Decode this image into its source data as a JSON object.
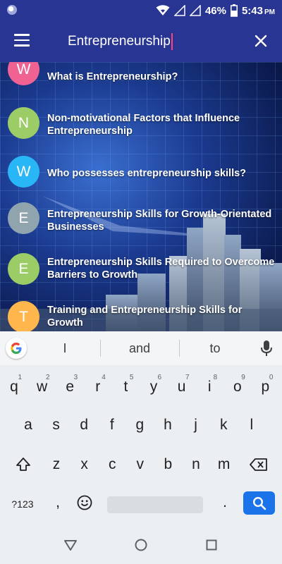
{
  "status_bar": {
    "battery_percent": "46%",
    "time": "5:43",
    "time_suffix": "PM",
    "icons": [
      "app-notification-icon",
      "wifi-icon",
      "no-sim-signal-icon",
      "no-sim-signal-icon",
      "battery-icon"
    ]
  },
  "app_bar": {
    "menu_icon": "hamburger-menu-icon",
    "search_value": "Entrepreneurship",
    "close_icon": "close-icon",
    "background_color": "#283593",
    "caret_color": "#ff4081"
  },
  "results": [
    {
      "letter": "W",
      "title": "What is Entrepreneurship?",
      "color": "#f06292"
    },
    {
      "letter": "N",
      "title": "Non-motivational Factors that Influence Entrepreneurship",
      "color": "#9ccc65"
    },
    {
      "letter": "W",
      "title": "Who possesses entrepreneurship skills?",
      "color": "#29b6f6"
    },
    {
      "letter": "E",
      "title": "Entrepreneurship Skills for Growth-Orientated Businesses",
      "color": "#90a4ae"
    },
    {
      "letter": "E",
      "title": "Entrepreneurship Skills Required to Overcome Barriers to Growth",
      "color": "#9ccc65"
    },
    {
      "letter": "T",
      "title": "Training and Entrepreneurship Skills for Growth",
      "color": "#ffb74d"
    }
  ],
  "keyboard": {
    "suggestions": [
      "I",
      "and",
      "to"
    ],
    "row1": [
      {
        "key": "q",
        "hint": "1"
      },
      {
        "key": "w",
        "hint": "2"
      },
      {
        "key": "e",
        "hint": "3"
      },
      {
        "key": "r",
        "hint": "4"
      },
      {
        "key": "t",
        "hint": "5"
      },
      {
        "key": "y",
        "hint": "6"
      },
      {
        "key": "u",
        "hint": "7"
      },
      {
        "key": "i",
        "hint": "8"
      },
      {
        "key": "o",
        "hint": "9"
      },
      {
        "key": "p",
        "hint": "0"
      }
    ],
    "row2": [
      "a",
      "s",
      "d",
      "f",
      "g",
      "h",
      "j",
      "k",
      "l"
    ],
    "row3": [
      "z",
      "x",
      "c",
      "v",
      "b",
      "n",
      "m"
    ],
    "symbols_label": "?123",
    "comma": ",",
    "period": ".",
    "enter_color": "#1a73e8"
  },
  "nav_bar": {
    "icons": [
      "back-triangle-icon",
      "home-circle-icon",
      "recents-square-icon"
    ]
  }
}
